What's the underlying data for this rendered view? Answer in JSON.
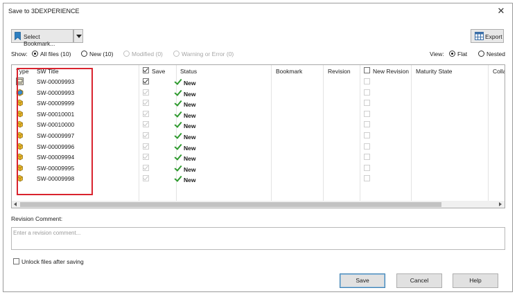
{
  "window": {
    "title": "Save to 3DEXPERIENCE",
    "close_glyph": "✕"
  },
  "toolbar": {
    "select_bookmark_label": "Select Bookmark...",
    "export_label": "Export"
  },
  "show_filter": {
    "label": "Show:",
    "options": [
      {
        "label": "All files (10)",
        "selected": true,
        "enabled": true
      },
      {
        "label": "New (10)",
        "selected": false,
        "enabled": true
      },
      {
        "label": "Modified (0)",
        "selected": false,
        "enabled": false
      },
      {
        "label": "Warning or Error (0)",
        "selected": false,
        "enabled": false
      }
    ]
  },
  "view_filter": {
    "label": "View:",
    "options": [
      {
        "label": "Flat",
        "selected": true
      },
      {
        "label": "Nested",
        "selected": false
      }
    ]
  },
  "table": {
    "columns": {
      "type": "Type",
      "sw_title": "SW Title",
      "save": "Save",
      "status": "Status",
      "bookmark": "Bookmark",
      "revision": "Revision",
      "new_revision": "New Revision",
      "maturity_state": "Maturity State",
      "collab": "Colla"
    },
    "rows": [
      {
        "type_icon": "drawing-icon",
        "sw_title": "SW-00009993",
        "status": "New"
      },
      {
        "type_icon": "assembly-icon",
        "sw_title": "SW-00009993",
        "status": "New"
      },
      {
        "type_icon": "part-icon",
        "sw_title": "SW-00009999",
        "status": "New"
      },
      {
        "type_icon": "part-icon",
        "sw_title": "SW-00010001",
        "status": "New"
      },
      {
        "type_icon": "part-icon",
        "sw_title": "SW-00010000",
        "status": "New"
      },
      {
        "type_icon": "part-icon",
        "sw_title": "SW-00009997",
        "status": "New"
      },
      {
        "type_icon": "part-icon",
        "sw_title": "SW-00009996",
        "status": "New"
      },
      {
        "type_icon": "part-icon",
        "sw_title": "SW-00009994",
        "status": "New"
      },
      {
        "type_icon": "part-icon",
        "sw_title": "SW-00009995",
        "status": "New"
      },
      {
        "type_icon": "part-icon",
        "sw_title": "SW-00009998",
        "status": "New"
      }
    ]
  },
  "revision_comment": {
    "label": "Revision Comment:",
    "placeholder": "Enter a revision comment..."
  },
  "unlock": {
    "label": "Unlock files after saving",
    "checked": false
  },
  "buttons": {
    "save": "Save",
    "cancel": "Cancel",
    "help": "Help"
  },
  "colors": {
    "highlight": "#d9232e",
    "status_check": "#2e9a2e",
    "part_icon": "#e8b62a"
  }
}
